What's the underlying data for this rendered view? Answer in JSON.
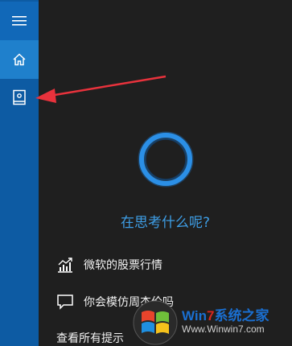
{
  "sidebar": {
    "items": [
      {
        "icon": "hamburger-menu-icon"
      },
      {
        "icon": "home-icon",
        "active": true
      },
      {
        "icon": "notebook-icon"
      }
    ],
    "accent": "#0d5ba3"
  },
  "cortana": {
    "prompt": "在思考什么呢?",
    "ring_color": "#1e7fd6",
    "suggestions": [
      {
        "icon": "stock-chart-icon",
        "label": "微软的股票行情"
      },
      {
        "icon": "chat-bubble-icon",
        "label": "你会模仿周杰伦吗"
      }
    ],
    "see_all": "查看所有提示"
  },
  "watermark": {
    "brand_part1": "Win",
    "brand_part2": "7",
    "brand_part3": "系统之家",
    "url": "Www.Winwin7.com"
  },
  "annotation": {
    "arrow_color": "#e8323c"
  }
}
